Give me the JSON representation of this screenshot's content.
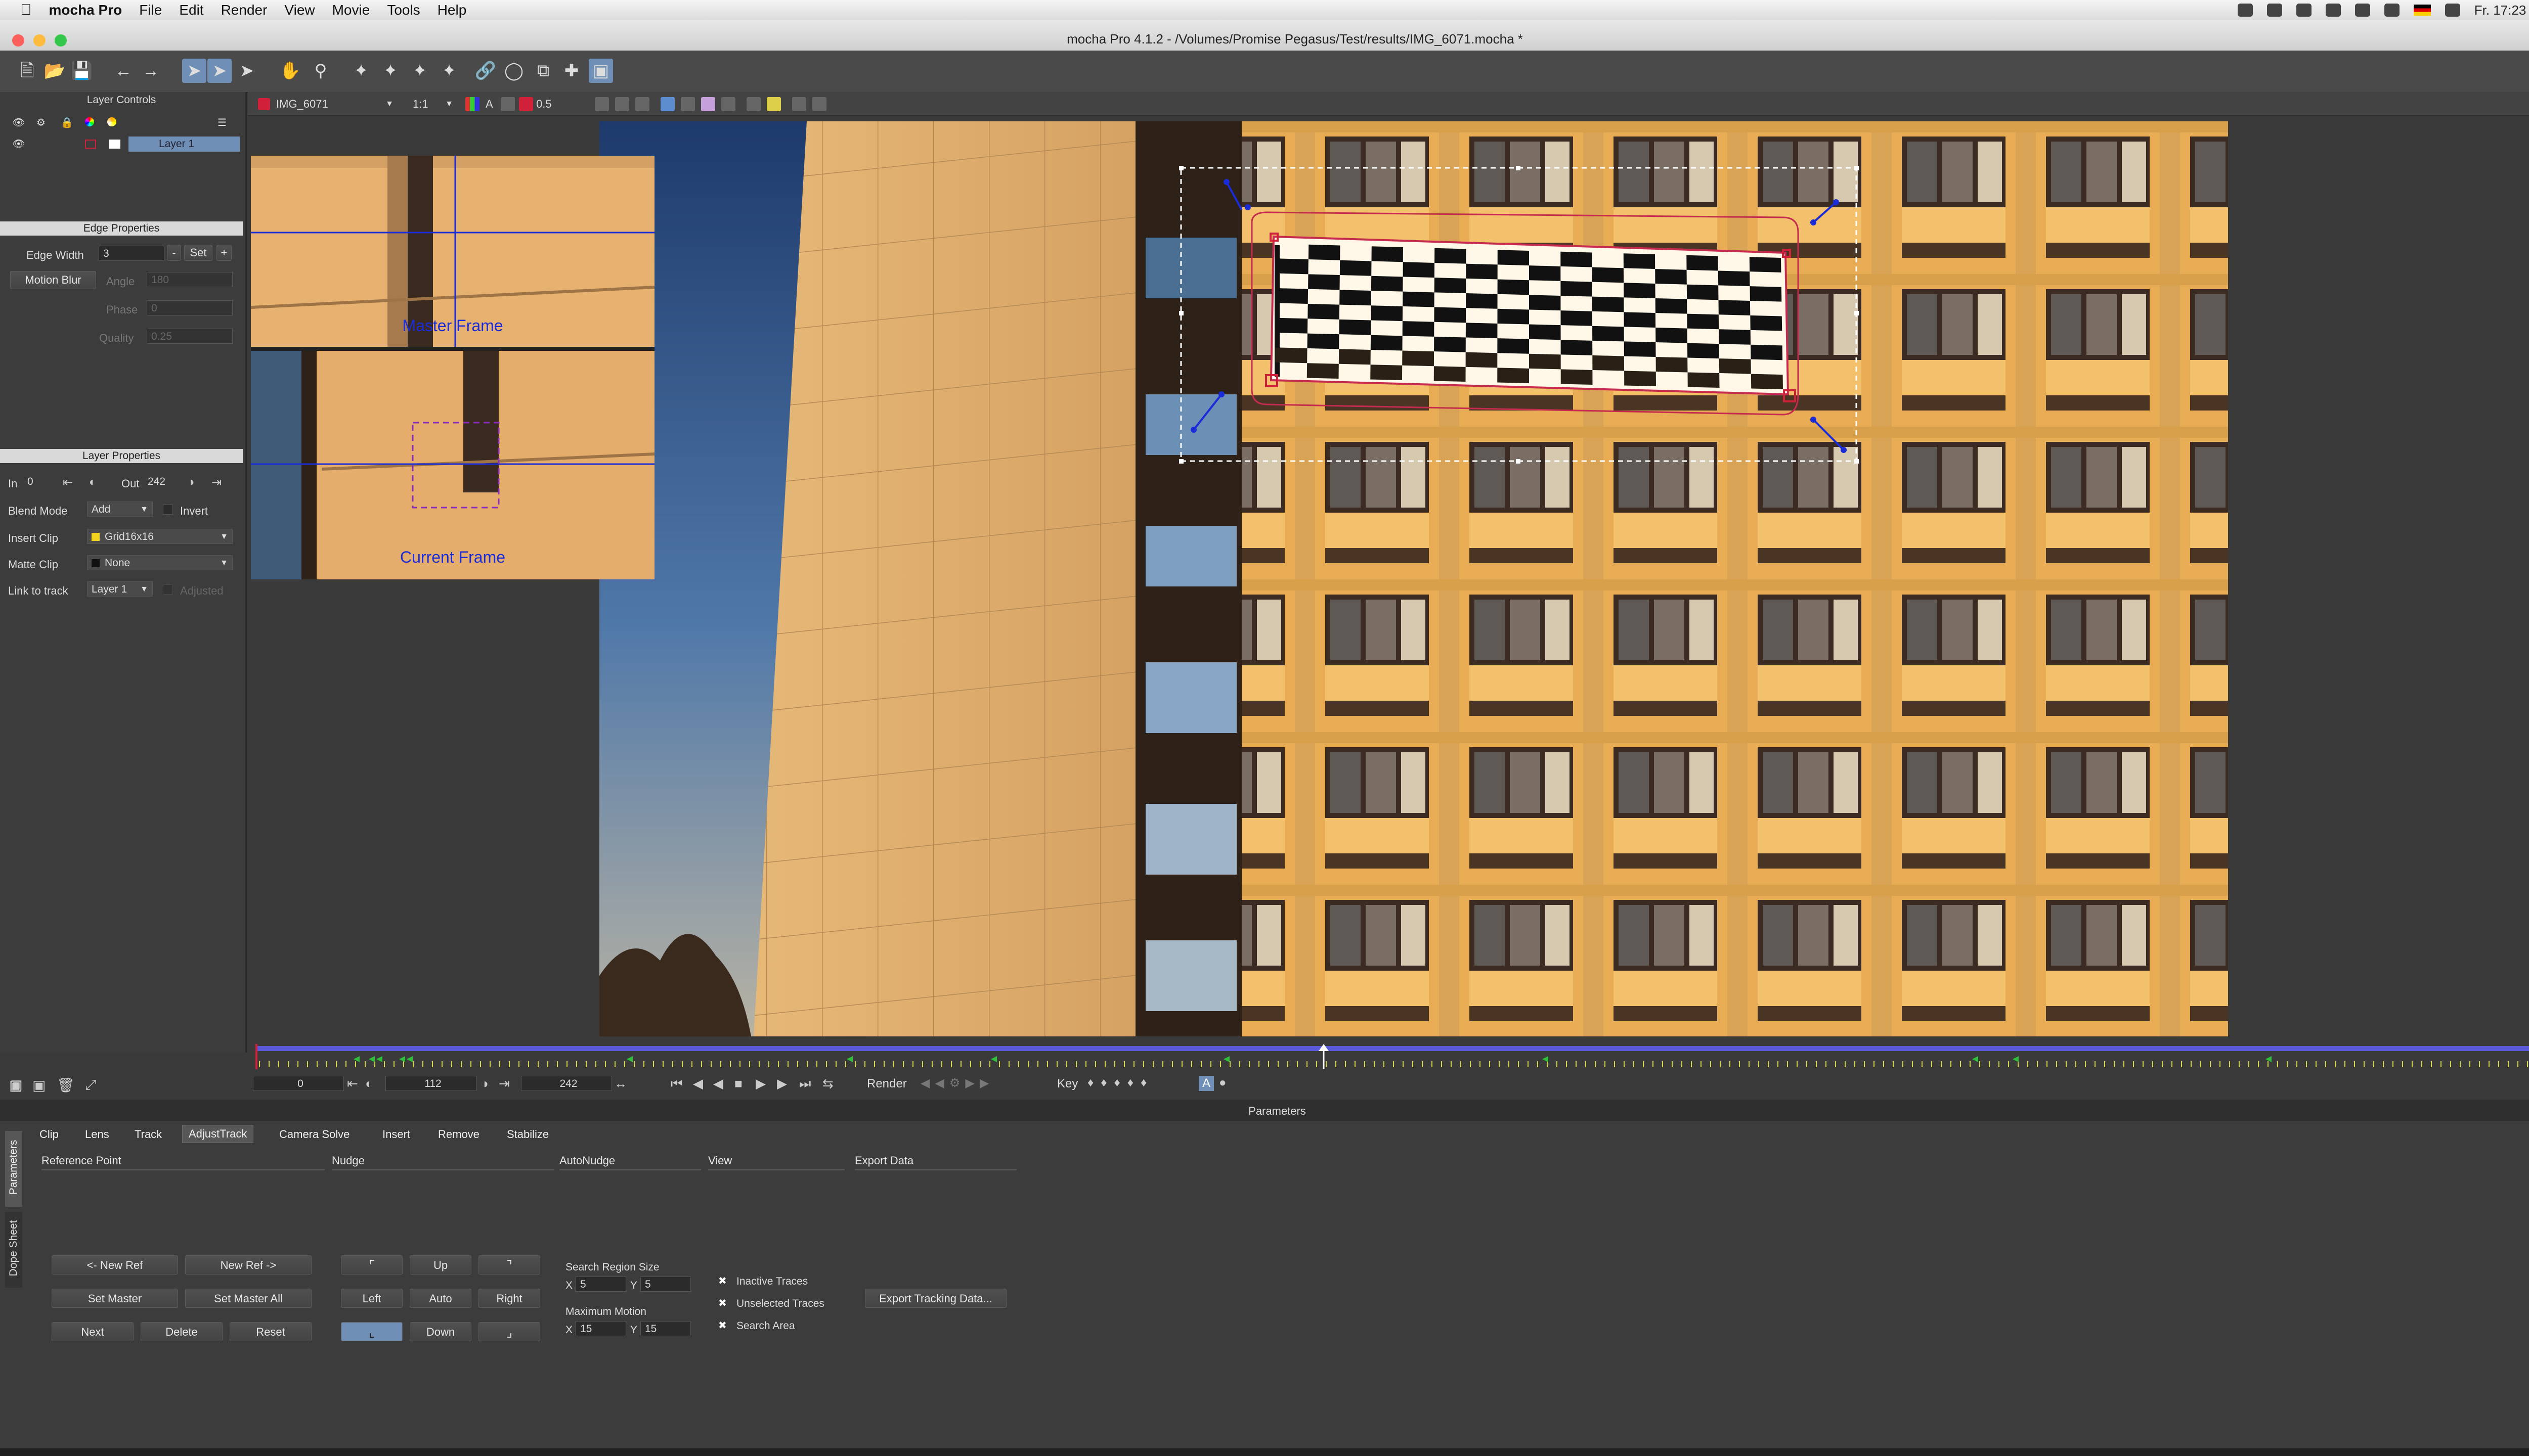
{
  "menubar": {
    "app": "mocha Pro",
    "items": [
      "File",
      "Edit",
      "Render",
      "View",
      "Movie",
      "Tools",
      "Help"
    ],
    "clock": "Fr. 17:23"
  },
  "window": {
    "title": "mocha Pro 4.1.2 - /Volumes/Promise Pegasus/Test/results/IMG_6071.mocha *"
  },
  "viewer_toolbar": {
    "clip": "IMG_6071",
    "zoom": "1:1",
    "opacity": "0.5",
    "a_label": "A"
  },
  "layer_controls": {
    "header": "Layer Controls",
    "layer_name": "Layer 1"
  },
  "edge_properties": {
    "header": "Edge Properties",
    "edge_width_label": "Edge Width",
    "edge_width": "3",
    "set": "Set",
    "minus": "-",
    "plus": "+",
    "motion_blur": "Motion Blur",
    "angle_label": "Angle",
    "angle": "180",
    "phase_label": "Phase",
    "phase": "0",
    "quality_label": "Quality",
    "quality": "0.25"
  },
  "layer_properties": {
    "header": "Layer Properties",
    "in_label": "In",
    "in": "0",
    "out_label": "Out",
    "out": "242",
    "blend_mode_label": "Blend Mode",
    "blend_mode": "Add",
    "invert": "Invert",
    "insert_clip_label": "Insert Clip",
    "insert_clip": "Grid16x16",
    "matte_clip_label": "Matte Clip",
    "matte_clip": "None",
    "link_to_track_label": "Link to track",
    "link_to_track": "Layer 1",
    "adjusted": "Adjusted"
  },
  "zoom_window": {
    "master_label": "Master Frame",
    "current_label": "Current Frame"
  },
  "transport": {
    "start": "0",
    "current": "112",
    "end": "242",
    "render": "Render",
    "key": "Key"
  },
  "parameters": {
    "title": "Parameters",
    "side_tabs": [
      "Parameters",
      "Dope Sheet"
    ],
    "tabs": [
      "Clip",
      "Lens",
      "Track",
      "AdjustTrack",
      "Camera Solve",
      "Insert",
      "Remove",
      "Stabilize"
    ],
    "active_tab": "AdjustTrack",
    "reference_point": {
      "header": "Reference Point",
      "new_ref_prev": "<- New Ref",
      "new_ref_next": "New Ref ->",
      "set_master": "Set Master",
      "set_master_all": "Set Master All",
      "next": "Next",
      "delete": "Delete",
      "reset": "Reset"
    },
    "nudge": {
      "header": "Nudge",
      "up": "Up",
      "left": "Left",
      "auto": "Auto",
      "right": "Right",
      "down": "Down"
    },
    "autonudge": {
      "header": "AutoNudge",
      "search_region_label": "Search Region Size",
      "x_label": "X",
      "y_label": "Y",
      "sr_x": "5",
      "sr_y": "5",
      "max_motion_label": "Maximum Motion",
      "mm_x": "15",
      "mm_y": "15"
    },
    "view": {
      "header": "View",
      "inactive_traces": "Inactive Traces",
      "unselected_traces": "Unselected Traces",
      "search_area": "Search Area"
    },
    "export": {
      "header": "Export Data",
      "button": "Export Tracking Data..."
    }
  },
  "colors": {
    "accent": "#6f8fb6",
    "track_red": "#d0203a",
    "spline_blue": "#1a2bd8",
    "timeline_blue": "#5a5ad8",
    "keyframe_green": "#2fbf3a"
  }
}
